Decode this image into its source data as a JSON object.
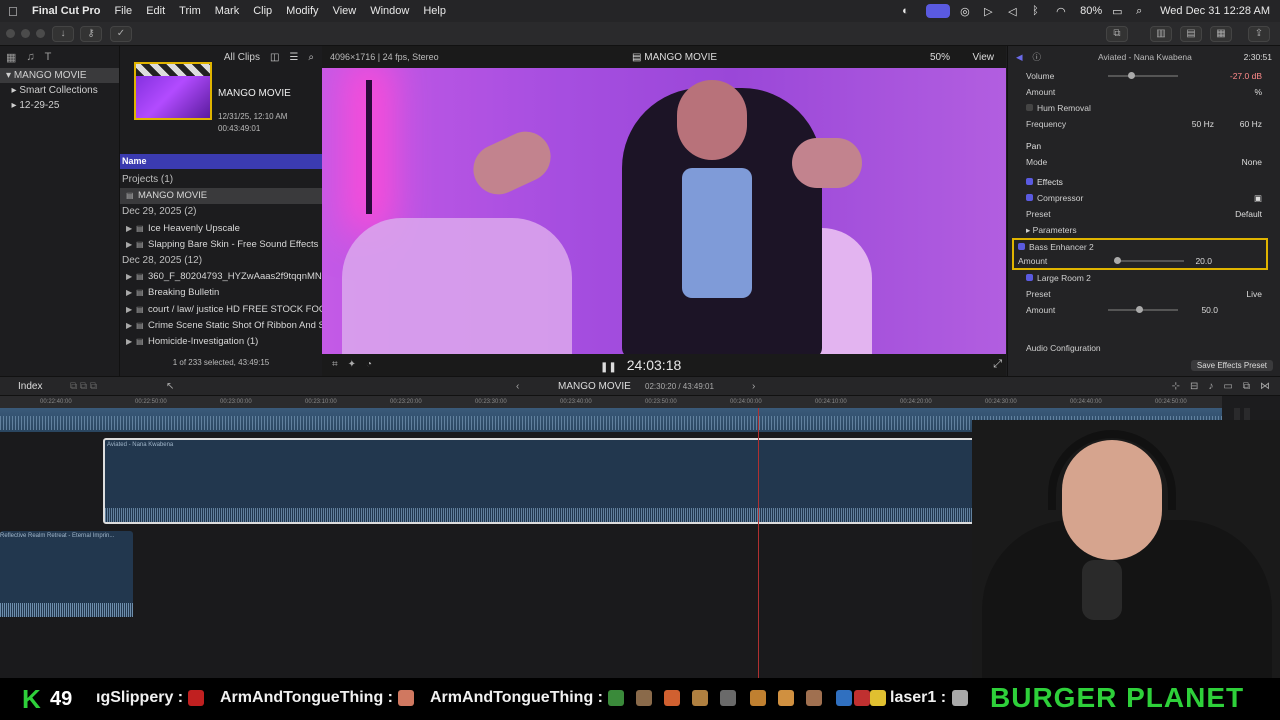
{
  "menubar": {
    "app_name": "Final Cut Pro",
    "items": [
      "File",
      "Edit",
      "Trim",
      "Mark",
      "Clip",
      "Modify",
      "View",
      "Window",
      "Help"
    ],
    "battery": "80%",
    "datetime": "Wed Dec 31  12:28 AM"
  },
  "libraries": {
    "rows": [
      "MANGO MOVIE",
      "Smart Collections",
      "12-29-25"
    ]
  },
  "browser": {
    "filter": "All Clips",
    "film_title": "MANGO MOVIE",
    "film_date": "12/31/25, 12:10 AM",
    "film_duration": "00:43:49:01",
    "name_header": "Name",
    "rows": [
      {
        "type": "group",
        "text": "Projects  (1)"
      },
      {
        "type": "item",
        "text": "MANGO MOVIE",
        "selected": true
      },
      {
        "type": "group",
        "text": "Dec 29, 2025  (2)"
      },
      {
        "type": "item",
        "text": "Ice Heavenly Upscale"
      },
      {
        "type": "item",
        "text": "Slapping Bare Skin - Free Sound Effects"
      },
      {
        "type": "group",
        "text": "Dec 28, 2025  (12)"
      },
      {
        "type": "item",
        "text": "360_F_80204793_HYZwAaas2f9tqqnMNpl"
      },
      {
        "type": "item",
        "text": "Breaking Bulletin"
      },
      {
        "type": "item",
        "text": "court / law/ justice HD FREE STOCK FOOTA"
      },
      {
        "type": "item",
        "text": "Crime Scene Static Shot Of Ribbon And Sir"
      },
      {
        "type": "item",
        "text": "Homicide-Investigation (1)"
      }
    ],
    "status": "1 of 233 selected, 43:49:15"
  },
  "viewer": {
    "format": "4096×1716 | 24 fps, Stereo",
    "title": "MANGO MOVIE",
    "zoom": "50%",
    "view": "View",
    "timecode": "24:03:18"
  },
  "inspector": {
    "clip_name": "Aviated - Nana Kwabena",
    "duration": "2:30:51",
    "volume_label": "Volume",
    "volume_value": "-27.0 dB",
    "amount_label": "Amount",
    "amount_pct": "%",
    "hum_removal": "Hum Removal",
    "frequency_label": "Frequency",
    "freq_50": "50 Hz",
    "freq_60": "60 Hz",
    "pan": "Pan",
    "mode_label": "Mode",
    "mode_value": "None",
    "effects": "Effects",
    "compressor": "Compressor",
    "preset_label": "Preset",
    "compressor_preset": "Default",
    "parameters": "Parameters",
    "bass_enhancer": "Bass Enhancer 2",
    "bass_amount": "20.0",
    "large_room": "Large Room 2",
    "large_room_preset": "Live",
    "large_room_amount": "50.0",
    "audio_config": "Audio Configuration",
    "save_preset": "Save Effects Preset"
  },
  "timeline": {
    "index": "Index",
    "project": "MANGO MOVIE",
    "time": "02:30:20 / 43:49:01",
    "main_clip_label": "Aviated - Nana Kwabena",
    "second_clip_label": "Reflective Realm Retreat - Eternal Imprin..."
  },
  "ticker": {
    "kick_letter": "K",
    "kick_count": "49",
    "messages": [
      "ıgSlippery :",
      "ArmAndTongueThing :",
      "ArmAndTongueThing :",
      "laser1 :"
    ],
    "banner": "BURGER PLANET"
  }
}
